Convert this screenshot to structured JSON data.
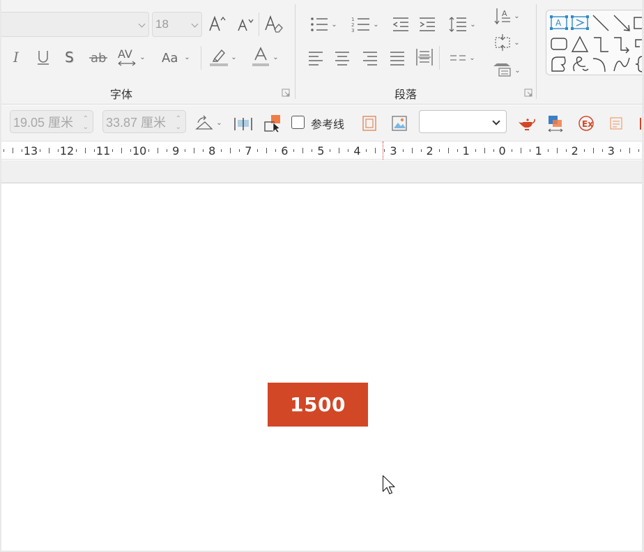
{
  "ribbon": {
    "font_group": {
      "label": "字体",
      "font_name_value": "",
      "font_size_value": "18"
    },
    "paragraph_group": {
      "label": "段落"
    }
  },
  "toolbar2": {
    "height_value": "19.05 厘米",
    "width_value": "33.87 厘米",
    "guides_label": "参考线",
    "style_select_value": ""
  },
  "ruler": {
    "labels": [
      "13",
      "12",
      "11",
      "10",
      "9",
      "8",
      "7",
      "6",
      "5",
      "4",
      "3",
      "2",
      "1",
      "0",
      "1",
      "2",
      "3"
    ]
  },
  "slide": {
    "box_text": "1500",
    "box_color": "#d24726"
  },
  "icons": {
    "increase_font": "increase-font-size-icon",
    "decrease_font": "decrease-font-size-icon",
    "clear_format": "clear-formatting-icon",
    "italic": "italic-icon",
    "underline": "underline-icon",
    "shadow": "text-shadow-icon",
    "strikethrough": "strikethrough-icon",
    "spacing": "character-spacing-icon",
    "change_case": "change-case-icon",
    "highlight": "highlight-color-icon",
    "font_color": "font-color-icon"
  },
  "colors": {
    "ribbon_bg": "#f3f3f3",
    "accent": "#d24726",
    "shape_blue": "#2e8bc9"
  }
}
